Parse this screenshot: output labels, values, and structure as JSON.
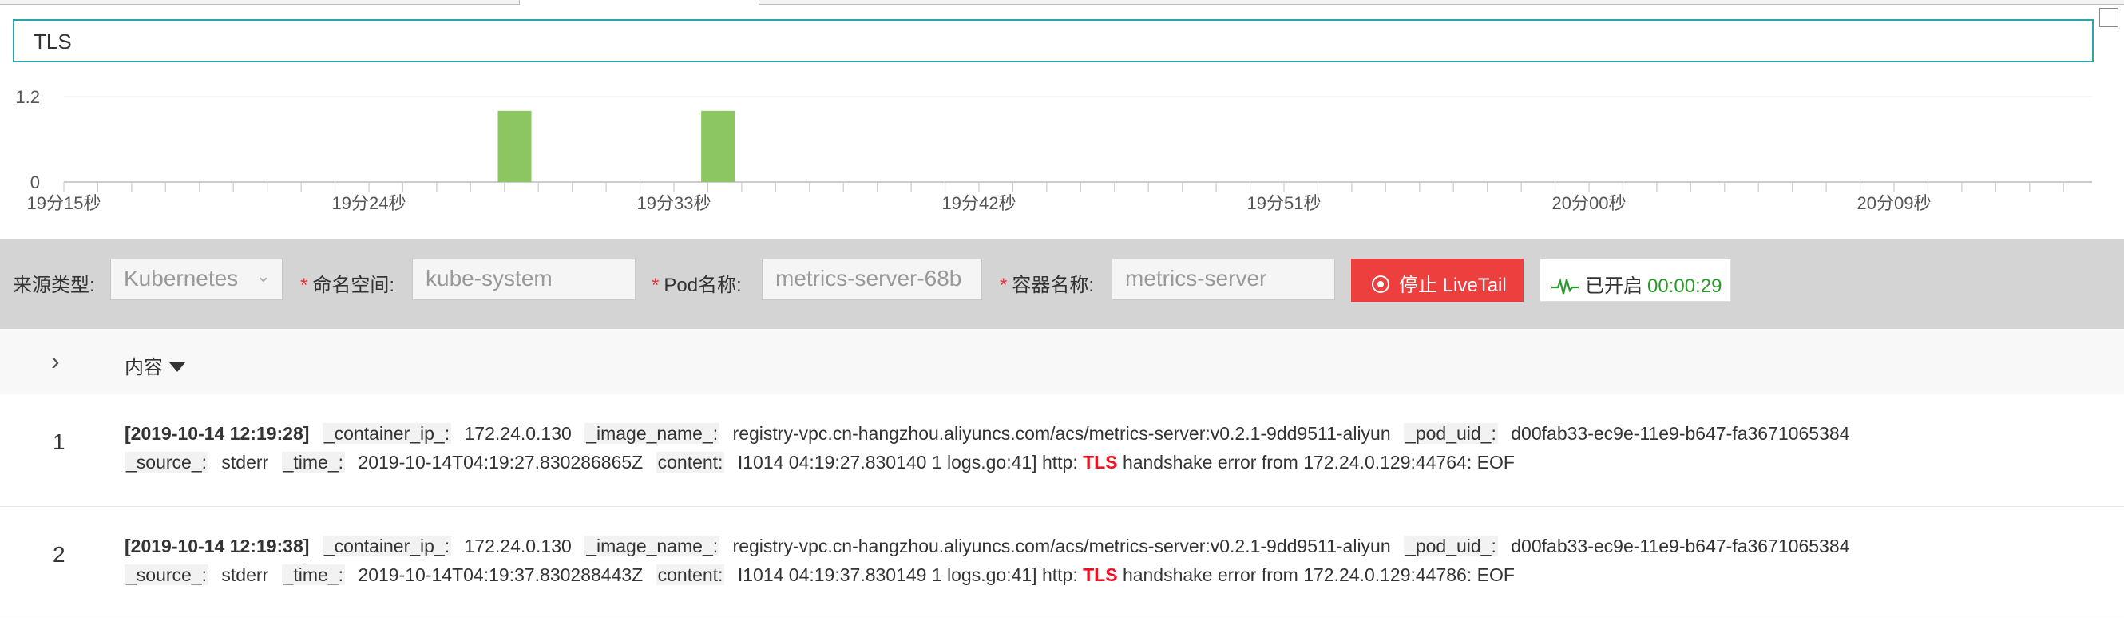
{
  "search": {
    "value": "TLS"
  },
  "chart_data": {
    "type": "bar",
    "y_ticks": [
      "1.2",
      "0"
    ],
    "x_tick_labels": [
      "19分15秒",
      "19分24秒",
      "19分33秒",
      "19分42秒",
      "19分51秒",
      "20分00秒",
      "20分09秒"
    ],
    "bars": [
      {
        "x": "19分28秒",
        "value": 1
      },
      {
        "x": "19分34秒",
        "value": 1
      }
    ],
    "ylim": [
      0,
      1.2
    ],
    "bar_color": "#8cc660",
    "grid": true
  },
  "filters": {
    "source_type_label": "来源类型:",
    "source_type_value": "Kubernetes",
    "namespace_label": "命名空间:",
    "namespace_value": "kube-system",
    "pod_label": "Pod名称:",
    "pod_value": "metrics-server-68b",
    "container_label": "容器名称:",
    "container_value": "metrics-server",
    "required_mark": "*",
    "stop_button": "停止 LiveTail",
    "status_label": "已开启",
    "status_timer": "00:00:29"
  },
  "table": {
    "header_content": "内容",
    "rows": [
      {
        "index": "1",
        "time": "[2019-10-14 12:19:28]",
        "container_ip_key": "_container_ip_:",
        "container_ip": "172.24.0.130",
        "image_name_key": "_image_name_:",
        "image_name": "registry-vpc.cn-hangzhou.aliyuncs.com/acs/metrics-server:v0.2.1-9dd9511-aliyun",
        "pod_uid_key": "_pod_uid_:",
        "pod_uid": "d00fab33-ec9e-11e9-b647-fa3671065384",
        "source_key": "_source_:",
        "source": "stderr",
        "time_key": "_time_:",
        "time_value": "2019-10-14T04:19:27.830286865Z",
        "content_key": "content:",
        "content_pre": "I1014 04:19:27.830140 1 logs.go:41] http:",
        "content_hl": "TLS",
        "content_post": "handshake error from 172.24.0.129:44764: EOF"
      },
      {
        "index": "2",
        "time": "[2019-10-14 12:19:38]",
        "container_ip_key": "_container_ip_:",
        "container_ip": "172.24.0.130",
        "image_name_key": "_image_name_:",
        "image_name": "registry-vpc.cn-hangzhou.aliyuncs.com/acs/metrics-server:v0.2.1-9dd9511-aliyun",
        "pod_uid_key": "_pod_uid_:",
        "pod_uid": "d00fab33-ec9e-11e9-b647-fa3671065384",
        "source_key": "_source_:",
        "source": "stderr",
        "time_key": "_time_:",
        "time_value": "2019-10-14T04:19:37.830288443Z",
        "content_key": "content:",
        "content_pre": "I1014 04:19:37.830149 1 logs.go:41] http:",
        "content_hl": "TLS",
        "content_post": "handshake error from 172.24.0.129:44786: EOF"
      }
    ]
  },
  "colors": {
    "accent_border": "#2aa6a8",
    "stop_button": "#ee3f3f",
    "timer": "#2a9a2a",
    "highlight": "#e12"
  }
}
